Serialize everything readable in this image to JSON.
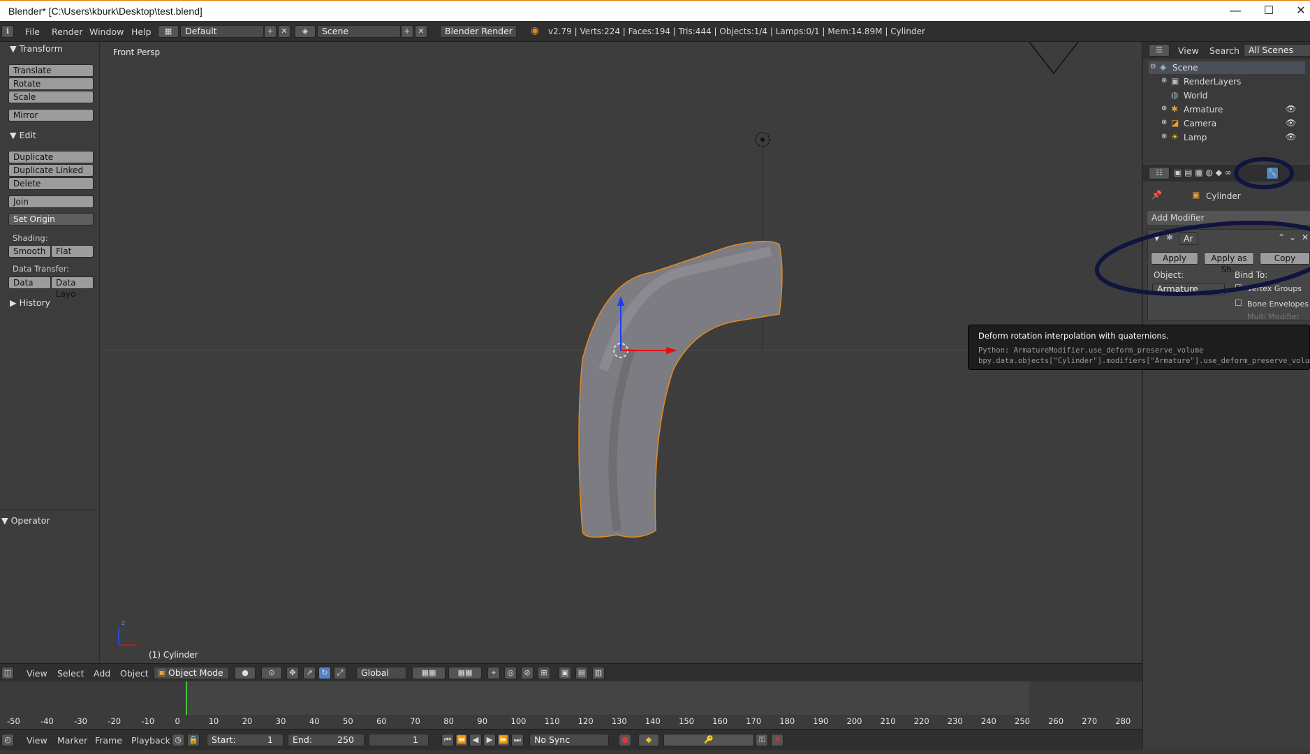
{
  "window": {
    "title": "Blender* [C:\\Users\\kburk\\Desktop\\test.blend]",
    "controls": {
      "minimize": "—",
      "maximize": "☐",
      "close": "✕"
    }
  },
  "infobar": {
    "menus": [
      "File",
      "Render",
      "Window",
      "Help"
    ],
    "layout": "Default",
    "scene": "Scene",
    "engine": "Blender Render",
    "stats": "v2.79 | Verts:224 | Faces:194 | Tris:444 | Objects:1/4 | Lamps:0/1 | Mem:14.89M | Cylinder"
  },
  "toolshelf": {
    "transform_header": "Transform",
    "transform_buttons": [
      "Translate",
      "Rotate",
      "Scale"
    ],
    "mirror": "Mirror",
    "edit_header": "Edit",
    "edit_buttons": [
      "Duplicate",
      "Duplicate Linked",
      "Delete"
    ],
    "join": "Join",
    "set_origin": "Set Origin",
    "shading_label": "Shading:",
    "smooth": "Smooth",
    "flat": "Flat",
    "data_transfer_label": "Data Transfer:",
    "data": "Data",
    "data_layout": "Data Layo",
    "history": "History",
    "operator": "Operator"
  },
  "viewport": {
    "view_label": "Front Persp",
    "object_label": "(1) Cylinder",
    "axis_z": "z"
  },
  "outliner": {
    "view": "View",
    "search": "Search",
    "filter": "All Scenes",
    "items": [
      {
        "label": "Scene"
      },
      {
        "label": "RenderLayers"
      },
      {
        "label": "World"
      },
      {
        "label": "Armature"
      },
      {
        "label": "Camera"
      },
      {
        "label": "Lamp"
      }
    ]
  },
  "properties": {
    "object_name": "Cylinder",
    "add_modifier": "Add Modifier",
    "modifier_name": "Ar",
    "apply": "Apply",
    "apply_as_shape": "Apply as Sh..",
    "copy": "Copy",
    "object_label": "Object:",
    "bind_to_label": "Bind To:",
    "object_value": "Armature",
    "vertex_groups": "Vertex Groups",
    "bone_envelopes": "Bone Envelopes",
    "multi_modifier": "Multi Modifier"
  },
  "tooltip": {
    "text": "Deform rotation interpolation with quaternions.",
    "python1": "Python: ArmatureModifier.use_deform_preserve_volume",
    "python2": "bpy.data.objects[\"Cylinder\"].modifiers[\"Armature\"].use_deform_preserve_volume"
  },
  "view_header": {
    "menus": [
      "View",
      "Select",
      "Add",
      "Object"
    ],
    "mode": "Object Mode",
    "orientation": "Global"
  },
  "timeline": {
    "ticks": [
      "-50",
      "-40",
      "-30",
      "-20",
      "-10",
      "0",
      "10",
      "20",
      "30",
      "40",
      "50",
      "60",
      "70",
      "80",
      "90",
      "100",
      "110",
      "120",
      "130",
      "140",
      "150",
      "160",
      "170",
      "180",
      "190",
      "200",
      "210",
      "220",
      "230",
      "240",
      "250",
      "260",
      "270",
      "280"
    ],
    "menus": [
      "View",
      "Marker",
      "Frame",
      "Playback"
    ],
    "start_label": "Start:",
    "start_value": "1",
    "end_label": "End:",
    "end_value": "250",
    "current": "1",
    "sync": "No Sync"
  }
}
